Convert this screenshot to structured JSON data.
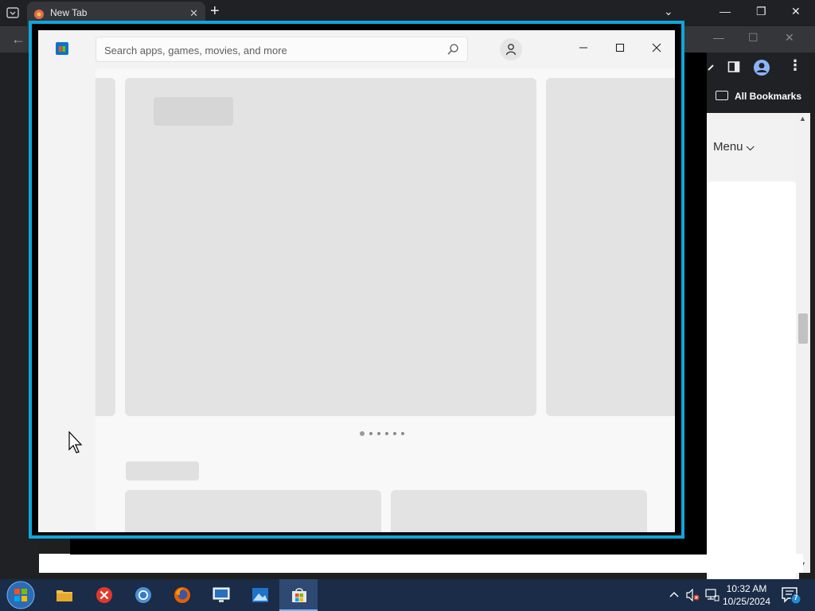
{
  "browser": {
    "tab_title": "New Tab",
    "bookmarks_label": "All Bookmarks",
    "page_menu_label": "Menu",
    "page_menu_chevron": "chevron-down-icon"
  },
  "store": {
    "search_placeholder": "Search apps, games, movies, and more",
    "search_icon": "search-icon",
    "account_icon": "person-icon",
    "window_controls": [
      "minimize",
      "maximize",
      "close"
    ],
    "carousel_dots": 6,
    "carousel_active_index": 0,
    "accent": "#0ea6dd"
  },
  "taskbar": {
    "apps": [
      {
        "name": "File Explorer",
        "icon": "folder-icon"
      },
      {
        "name": "Red X App",
        "icon": "red-x-icon"
      },
      {
        "name": "Google Chrome",
        "icon": "chrome-icon"
      },
      {
        "name": "Firefox",
        "icon": "firefox-icon"
      },
      {
        "name": "Remote Desktop",
        "icon": "remote-desktop-icon"
      },
      {
        "name": "Photos",
        "icon": "photos-icon"
      },
      {
        "name": "Microsoft Store",
        "icon": "store-icon"
      }
    ],
    "time": "10:32 AM",
    "date": "10/25/2024",
    "notification_count": "7"
  }
}
